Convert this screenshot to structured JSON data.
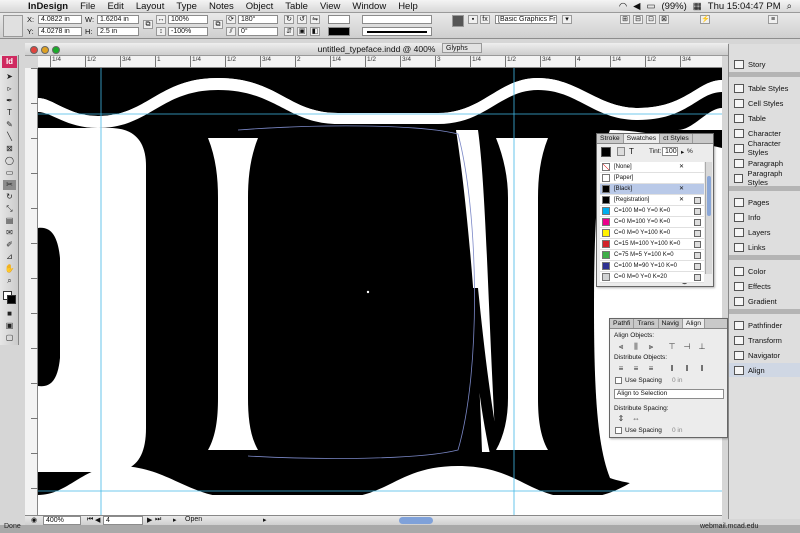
{
  "menubar": {
    "app_name": "InDesign",
    "items": [
      "File",
      "Edit",
      "Layout",
      "Type",
      "Notes",
      "Object",
      "Table",
      "View",
      "Window",
      "Help"
    ],
    "battery": "(99%)",
    "clock": "Thu 15:04:47 PM"
  },
  "control": {
    "x_label": "X:",
    "x_value": "4.0822 in",
    "y_label": "Y:",
    "y_value": "4.0278 in",
    "w_label": "W:",
    "w_value": "1.6204 in",
    "h_label": "H:",
    "h_value": "2.5 in",
    "scale_x": "100%",
    "scale_y": "-100%",
    "rotation": "180°",
    "shear": "0°",
    "style_dropdown": "[Basic Graphics Frame]+"
  },
  "document": {
    "title": "untitled_typeface.indd @ 400%",
    "glyphs_tab": "Glyphs"
  },
  "ruler": {
    "labels": [
      "1/4",
      "1/2",
      "3/4",
      "1",
      "1/4",
      "1/2",
      "3/4",
      "2",
      "1/4",
      "1/2",
      "3/4",
      "3",
      "1/4",
      "1/2",
      "3/4",
      "4",
      "1/4",
      "1/2",
      "3/4"
    ]
  },
  "panels": {
    "items": [
      {
        "label": "Story",
        "icon": "story-icon"
      },
      {
        "label": "Table Styles",
        "icon": "table-styles-icon"
      },
      {
        "label": "Cell Styles",
        "icon": "cell-styles-icon"
      },
      {
        "label": "Table",
        "icon": "table-icon"
      },
      {
        "label": "Character",
        "icon": "character-icon"
      },
      {
        "label": "Character Styles",
        "icon": "character-styles-icon"
      },
      {
        "label": "Paragraph",
        "icon": "paragraph-icon"
      },
      {
        "label": "Paragraph Styles",
        "icon": "paragraph-styles-icon"
      },
      {
        "label": "Pages",
        "icon": "pages-icon"
      },
      {
        "label": "Info",
        "icon": "info-icon"
      },
      {
        "label": "Layers",
        "icon": "layers-icon"
      },
      {
        "label": "Links",
        "icon": "links-icon"
      },
      {
        "label": "Color",
        "icon": "color-icon"
      },
      {
        "label": "Effects",
        "icon": "effects-icon"
      },
      {
        "label": "Gradient",
        "icon": "gradient-icon"
      },
      {
        "label": "Pathfinder",
        "icon": "pathfinder-icon"
      },
      {
        "label": "Transform",
        "icon": "transform-icon"
      },
      {
        "label": "Navigator",
        "icon": "navigator-icon"
      },
      {
        "label": "Align",
        "icon": "align-icon"
      }
    ]
  },
  "swatches": {
    "tabs": [
      "Stroke",
      "Swatches",
      "ct Styles"
    ],
    "tint_label": "Tint:",
    "tint_value": "100",
    "tint_unit": "%",
    "rows": [
      {
        "name": "[None]",
        "color": "#ffffff"
      },
      {
        "name": "[Paper]",
        "color": "#ffffff"
      },
      {
        "name": "[Black]",
        "color": "#000000"
      },
      {
        "name": "[Registration]",
        "color": "#000000"
      },
      {
        "name": "C=100 M=0 Y=0 K=0",
        "color": "#00aeef"
      },
      {
        "name": "C=0 M=100 Y=0 K=0",
        "color": "#ec008c"
      },
      {
        "name": "C=0 M=0 Y=100 K=0",
        "color": "#fff200"
      },
      {
        "name": "C=15 M=100 Y=100 K=0",
        "color": "#d2232a"
      },
      {
        "name": "C=75 M=5 Y=100 K=0",
        "color": "#3fae49"
      },
      {
        "name": "C=100 M=90 Y=10 K=0",
        "color": "#2e3192"
      },
      {
        "name": "C=0 M=0 Y=0 K=20",
        "color": "#d1d3d4"
      }
    ]
  },
  "align": {
    "tabs": [
      "Pathfi",
      "Trans",
      "Navig",
      "Align"
    ],
    "align_objects": "Align Objects:",
    "distribute_objects": "Distribute Objects:",
    "use_spacing": "Use Spacing",
    "spacing_value": "0 in",
    "align_to": "Align to Selection",
    "distribute_spacing": "Distribute Spacing:"
  },
  "status": {
    "zoom": "400%",
    "page": "4",
    "state": "Open",
    "done": "Done",
    "host": "webmail.mcad.edu"
  },
  "colors": {
    "ink": "#000000",
    "guide": "#41b8e6",
    "selection": "#7b88c7"
  }
}
